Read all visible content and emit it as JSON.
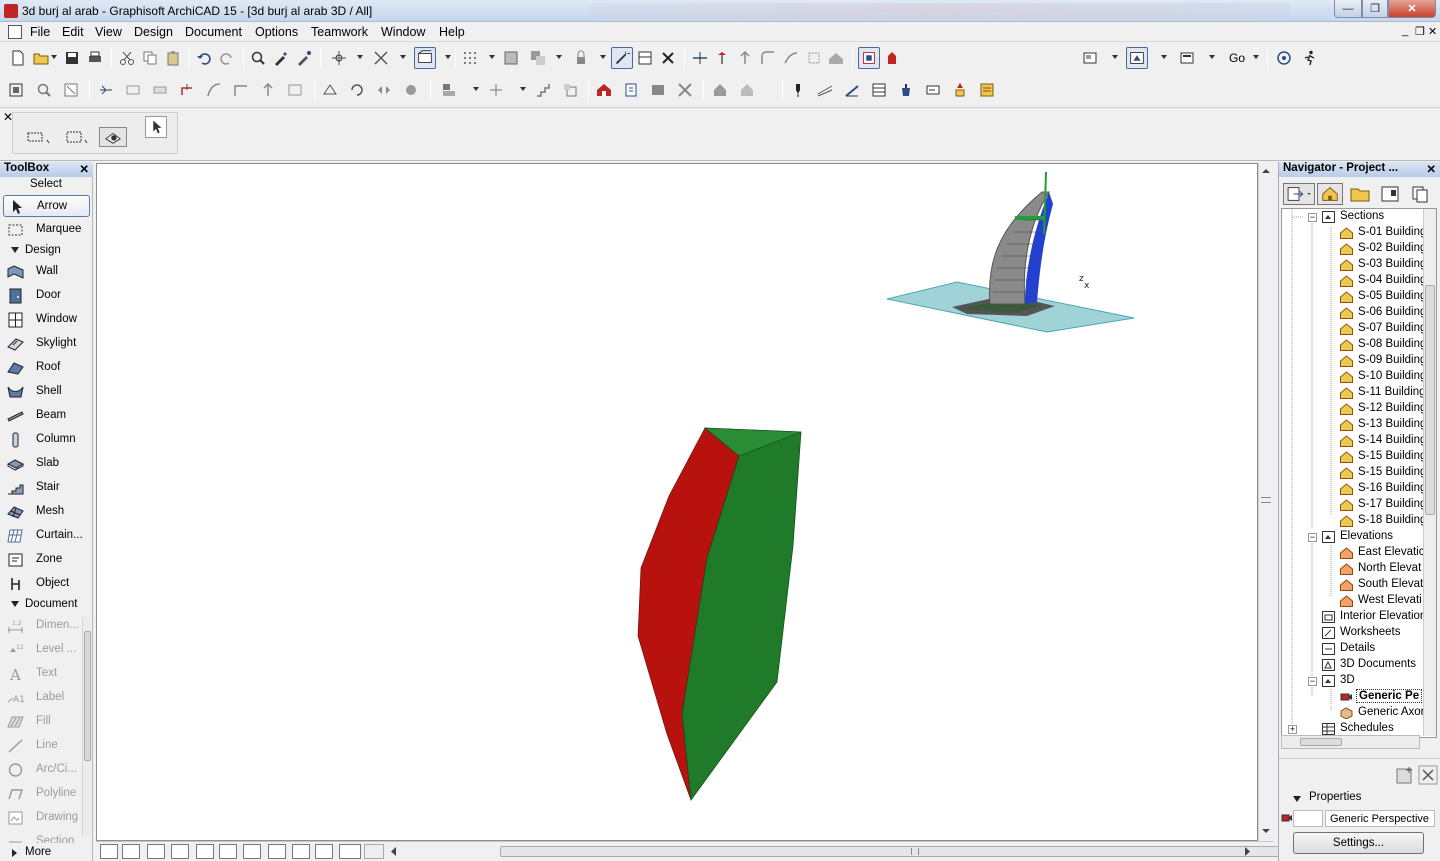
{
  "window": {
    "title": "3d burj al arab - Graphisoft ArchiCAD 15 - [3d burj al arab 3D / All]",
    "min_glyph": "—",
    "max_glyph": "❐",
    "close_glyph": "✕"
  },
  "menu": {
    "items": [
      "File",
      "Edit",
      "View",
      "Design",
      "Document",
      "Options",
      "Teamwork",
      "Window",
      "Help"
    ],
    "mdi_min": "_",
    "mdi_restore": "❐",
    "mdi_close": "✕"
  },
  "toolbar": {
    "go_label": "Go"
  },
  "toolbox": {
    "title": "ToolBox",
    "close": "✕",
    "select_heading": "Select",
    "select_tools": [
      "Arrow",
      "Marquee"
    ],
    "design_heading": "Design",
    "design_tools": [
      "Wall",
      "Door",
      "Window",
      "Skylight",
      "Roof",
      "Shell",
      "Beam",
      "Column",
      "Slab",
      "Stair",
      "Mesh",
      "Curtain...",
      "Zone",
      "Object"
    ],
    "document_heading": "Document",
    "document_tools": [
      "Dimen...",
      "Level ...",
      "Text",
      "Label",
      "Fill",
      "Line",
      "Arc/Ci...",
      "Polyline",
      "Drawing",
      "Section"
    ],
    "more_label": "More"
  },
  "viewport": {
    "axis_z": "z",
    "axis_x": "x"
  },
  "navigator": {
    "title": "Navigator - Project ...",
    "close": "✕",
    "sections_label": "Sections",
    "sections": [
      "S-01 Building",
      "S-02 Building",
      "S-03 Building",
      "S-04 Building",
      "S-05 Building",
      "S-06 Building",
      "S-07 Building",
      "S-08 Building",
      "S-09 Building",
      "S-10 Building",
      "S-11 Building",
      "S-12 Building",
      "S-13 Building",
      "S-14 Building",
      "S-15 Building",
      "S-15 Building",
      "S-16 Building",
      "S-17 Building",
      "S-18 Building"
    ],
    "elevations_label": "Elevations",
    "elevations": [
      "East Elevatic",
      "North Elevat",
      "South Elevat",
      "West Elevati"
    ],
    "other_items": [
      "Interior Elevation",
      "Worksheets",
      "Details",
      "3D Documents",
      "3D"
    ],
    "threed_items": [
      "Generic Pe",
      "Generic Axor"
    ],
    "schedules_label": "Schedules",
    "properties_label": "Properties",
    "properties_value": "Generic Perspective",
    "settings_label": "Settings..."
  },
  "colors": {
    "model_red": "#b8120e",
    "model_green": "#1f7a29",
    "site_cyan": "#9fd3d8",
    "tower_grey": "#8a8a8a"
  }
}
